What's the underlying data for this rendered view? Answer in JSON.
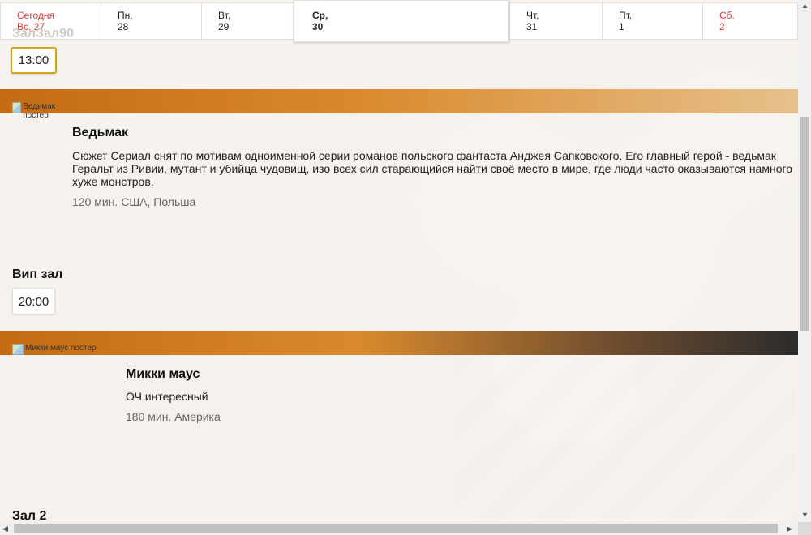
{
  "dates": [
    {
      "top": "Сегодня",
      "bottom": "Вс, 27",
      "red": true
    },
    {
      "top": "Пн,",
      "bottom": "28",
      "red": false
    },
    {
      "top": "Вт,",
      "bottom": "29",
      "red": false
    },
    {
      "top": "Ср,",
      "bottom": "30",
      "red": false,
      "active": true
    },
    {
      "top": "Чт,",
      "bottom": "31",
      "red": false
    },
    {
      "top": "Пт,",
      "bottom": "1",
      "red": false
    },
    {
      "top": "Сб,",
      "bottom": "2",
      "red": true
    }
  ],
  "hall_top_label": "ЗалЗал90",
  "times": {
    "first": "13:00",
    "vip": "20:00"
  },
  "movies": [
    {
      "poster_alt": "Ведьмак постер",
      "title": "Ведьмак",
      "description": "Сюжет Сериал снят по мотивам одноименной серии романов польского фантаста Анджея Сапковского. Его главный герой - ведьмак Геральт из Ривии, мутант и убийца чудовищ, изо всех сил старающийся найти своё место в мире, где люди часто оказываются намного хуже монстров.",
      "meta": "120 мин. США, Польша",
      "hall": "Вип зал"
    },
    {
      "poster_alt": "Микки маус постер",
      "title": "Микки маус",
      "description": "ОЧ интересный",
      "meta": "180 мин. Америка",
      "hall": "Зал 2"
    }
  ],
  "colors": {
    "accent_red": "#e23a3a",
    "selected_outline": "#d5a21c"
  },
  "icons": {
    "broken_image": "broken-image-icon",
    "scroll_up": "▲",
    "scroll_down": "▼",
    "scroll_left": "◀",
    "scroll_right": "▶"
  }
}
